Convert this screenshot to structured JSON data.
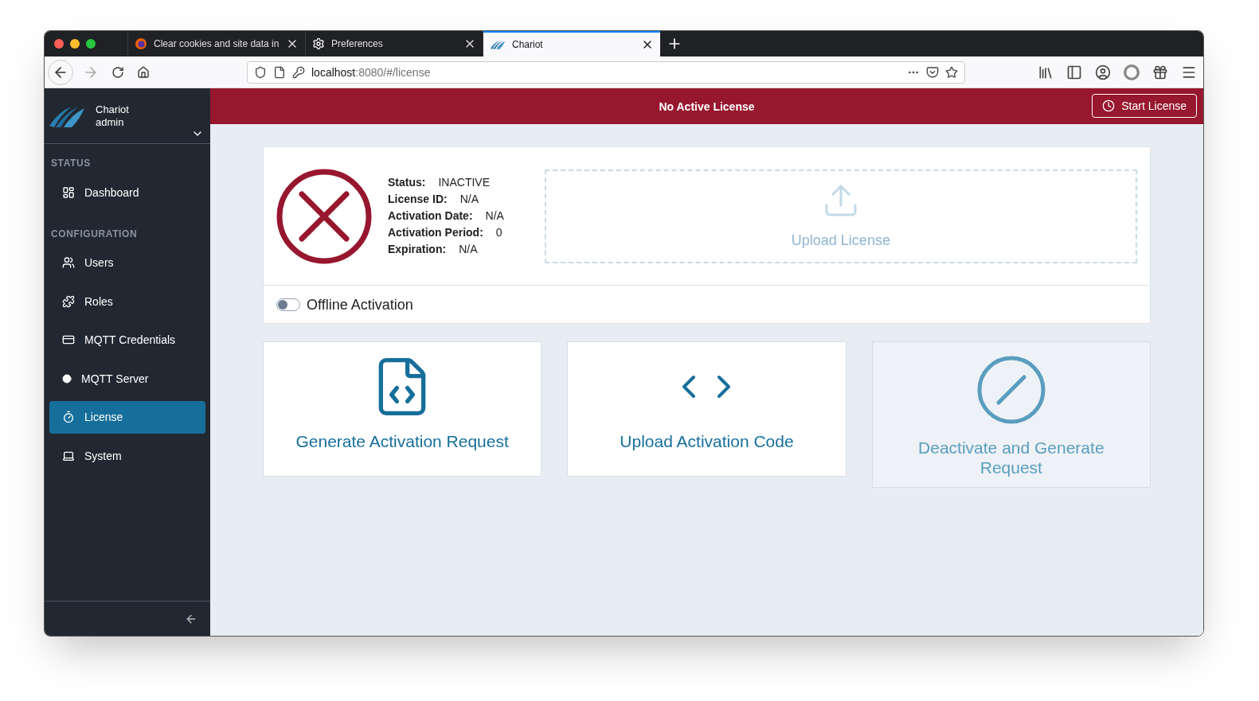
{
  "browser": {
    "tabs": [
      {
        "title": "Clear cookies and site data in",
        "kind": "firefox",
        "selected": false
      },
      {
        "title": "Preferences",
        "kind": "gear",
        "selected": false
      },
      {
        "title": "Chariot",
        "kind": "logo",
        "selected": true
      }
    ],
    "url": {
      "host": "localhost",
      "rest": ":8080/#/license"
    }
  },
  "sidebar": {
    "app_name": "Chariot",
    "user": "admin",
    "sections": [
      {
        "heading": "STATUS",
        "items": [
          {
            "label": "Dashboard",
            "kind": "dashboard",
            "selected": false
          }
        ]
      },
      {
        "heading": "CONFIGURATION",
        "items": [
          {
            "label": "Users",
            "kind": "users",
            "selected": false
          },
          {
            "label": "Roles",
            "kind": "roles",
            "selected": false
          },
          {
            "label": "MQTT Credentials",
            "kind": "credentials",
            "selected": false
          },
          {
            "label": "MQTT Server",
            "kind": "server",
            "selected": false
          },
          {
            "label": "License",
            "kind": "license",
            "selected": true
          },
          {
            "label": "System",
            "kind": "system",
            "selected": false
          }
        ]
      }
    ]
  },
  "banner": {
    "title": "No Active License",
    "button": "Start License"
  },
  "license": {
    "fields": [
      {
        "label": "Status:",
        "value": "INACTIVE"
      },
      {
        "label": "License ID:",
        "value": "N/A"
      },
      {
        "label": "Activation Date:",
        "value": "N/A"
      },
      {
        "label": "Activation Period:",
        "value": "0"
      },
      {
        "label": "Expiration:",
        "value": "N/A"
      }
    ],
    "upload": {
      "label": "Upload License"
    },
    "offline_activation": {
      "label": "Offline Activation",
      "on": false
    }
  },
  "actions": [
    {
      "label": "Generate Activation Request",
      "kind": "file-code",
      "disabled": false
    },
    {
      "label": "Upload Activation Code",
      "kind": "code",
      "disabled": false
    },
    {
      "label": "Deactivate and Generate Request",
      "kind": "slash",
      "disabled": true
    }
  ]
}
